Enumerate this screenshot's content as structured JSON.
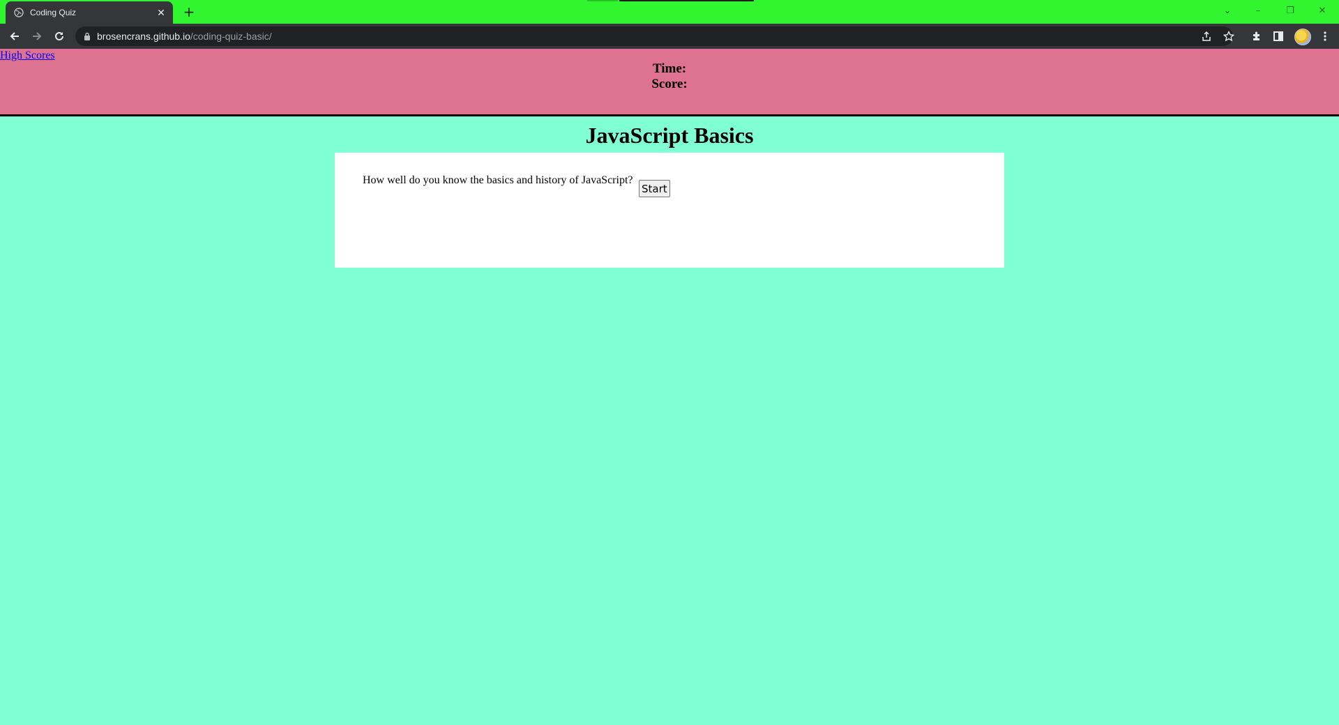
{
  "browser": {
    "tab_title": "Coding Quiz",
    "tab_close_glyph": "✕",
    "new_tab_glyph": "+",
    "url_host": "brosencrans.github.io",
    "url_path": "/coding-quiz-basic/",
    "window_controls": [
      "⌄",
      "–",
      "❐",
      "✕"
    ]
  },
  "header": {
    "high_scores_link": "High Scores",
    "time_label": "Time:",
    "score_label": "Score:"
  },
  "main": {
    "title": "JavaScript Basics",
    "intro_text": "How well do you know the basics and history of JavaScript?",
    "start_button": "Start"
  },
  "colors": {
    "tabstrip": "#31f52e",
    "header_bg": "#de7391",
    "page_bg": "#80ffd4",
    "card_bg": "#ffffff",
    "link": "#0000ee"
  }
}
